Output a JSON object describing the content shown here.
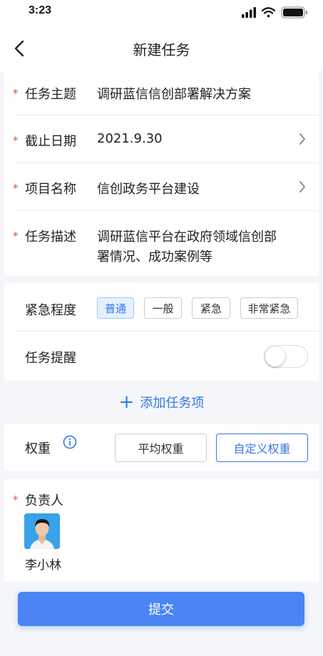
{
  "status": {
    "time": "3:23"
  },
  "nav": {
    "title": "新建任务"
  },
  "form": {
    "subject": {
      "label": "任务主题",
      "value": "调研蓝信信创部署解决方案"
    },
    "deadline": {
      "label": "截止日期",
      "value": "2021.9.30"
    },
    "project": {
      "label": "项目名称",
      "value": "信创政务平台建设"
    },
    "description": {
      "label": "任务描述",
      "line1": "调研蓝信平台在政府领域信创部",
      "line2": "署情况、成功案例等"
    },
    "urgency": {
      "label": "紧急程度",
      "options": [
        "普通",
        "一般",
        "紧急",
        "非常紧急"
      ],
      "selected": "普通"
    },
    "reminder": {
      "label": "任务提醒",
      "enabled": false
    }
  },
  "add_item": {
    "label": "添加任务项"
  },
  "weight": {
    "label": "权重",
    "options": [
      "平均权重",
      "自定义权重"
    ],
    "selected": "自定义权重"
  },
  "assignee": {
    "label": "负责人",
    "name": "李小林"
  },
  "submit": {
    "label": "提交"
  },
  "colors": {
    "accent": "#3577e5",
    "required": "#e9474a",
    "submit_bg": "#4a84f5"
  },
  "icons": [
    "back-chevron-icon",
    "chevron-right-icon",
    "info-icon",
    "plus-icon",
    "signal-icon",
    "wifi-icon",
    "battery-icon"
  ]
}
